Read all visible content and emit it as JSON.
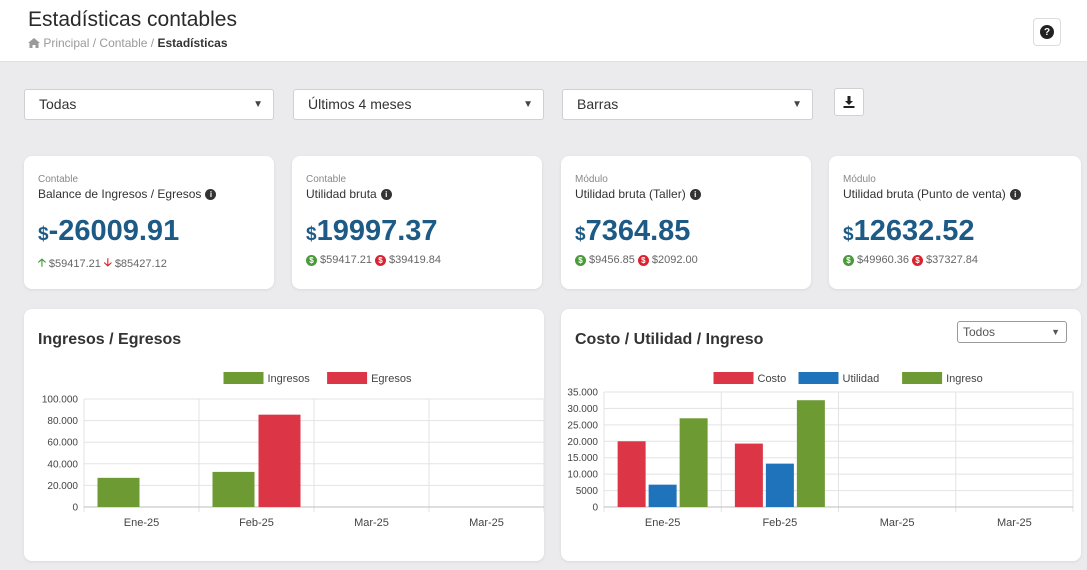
{
  "header": {
    "title": "Estadísticas contables",
    "breadcrumb": {
      "home": "Principal",
      "sep": "/",
      "mid": "Contable",
      "current": "Estadísticas"
    },
    "help_label": "?"
  },
  "filters": {
    "scope": "Todas",
    "period": "Últimos 4 meses",
    "chart_type": "Barras"
  },
  "cards": [
    {
      "kicker": "Contable",
      "title": "Balance de Ingresos / Egresos",
      "currency": "$",
      "value": "-26009.91",
      "in": "$59417.21",
      "out": "$85427.12"
    },
    {
      "kicker": "Contable",
      "title": "Utilidad bruta",
      "currency": "$",
      "value": "19997.37",
      "in": "$59417.21",
      "out": "$39419.84"
    },
    {
      "kicker": "Módulo",
      "title": "Utilidad bruta (Taller)",
      "currency": "$",
      "value": "7364.85",
      "in": "$9456.85",
      "out": "$2092.00"
    },
    {
      "kicker": "Módulo",
      "title": "Utilidad bruta (Punto de venta)",
      "currency": "$",
      "value": "12632.52",
      "in": "$49960.36",
      "out": "$37327.84"
    }
  ],
  "icons": {
    "info": "info-circle-icon",
    "help": "question-circle-icon",
    "download": "download-icon",
    "up": "arrow-up-icon",
    "down": "arrow-down-icon",
    "coin_in": "dollar-circle-icon",
    "coin_out": "dollar-circle-icon"
  },
  "colors": {
    "primary": "#1d5a86",
    "green": "#6e9a33",
    "red": "#dc3545",
    "blue": "#1f73bb"
  },
  "chart_filter": "Todos",
  "chart_data": [
    {
      "type": "bar",
      "title": "Ingresos / Egresos",
      "categories": [
        "Ene-25",
        "Feb-25",
        "Mar-25",
        "Mar-25"
      ],
      "series": [
        {
          "name": "Ingresos",
          "color": "#6e9a33",
          "values": [
            27000,
            32500,
            0,
            0
          ]
        },
        {
          "name": "Egresos",
          "color": "#dc3545",
          "values": [
            0,
            85500,
            0,
            0
          ]
        }
      ],
      "ylim": [
        0,
        100000
      ],
      "yticks": [
        0,
        20000,
        40000,
        60000,
        80000,
        100000
      ],
      "ytick_labels": [
        "0",
        "20.000",
        "40.000",
        "60.000",
        "80.000",
        "100.000"
      ],
      "legend": "top-center",
      "grid": true
    },
    {
      "type": "bar",
      "title": "Costo / Utilidad / Ingreso",
      "categories": [
        "Ene-25",
        "Feb-25",
        "Mar-25",
        "Mar-25"
      ],
      "series": [
        {
          "name": "Costo",
          "color": "#dc3545",
          "values": [
            20000,
            19300,
            0,
            0
          ]
        },
        {
          "name": "Utilidad",
          "color": "#1f73bb",
          "values": [
            6800,
            13200,
            0,
            0
          ]
        },
        {
          "name": "Ingreso",
          "color": "#6e9a33",
          "values": [
            27000,
            32500,
            0,
            0
          ]
        }
      ],
      "ylim": [
        0,
        35000
      ],
      "yticks": [
        0,
        5000,
        10000,
        15000,
        20000,
        25000,
        30000,
        35000
      ],
      "ytick_labels": [
        "0",
        "5000",
        "10.000",
        "15.000",
        "20.000",
        "25.000",
        "30.000",
        "35.000"
      ],
      "legend": "top-center",
      "grid": true
    }
  ]
}
